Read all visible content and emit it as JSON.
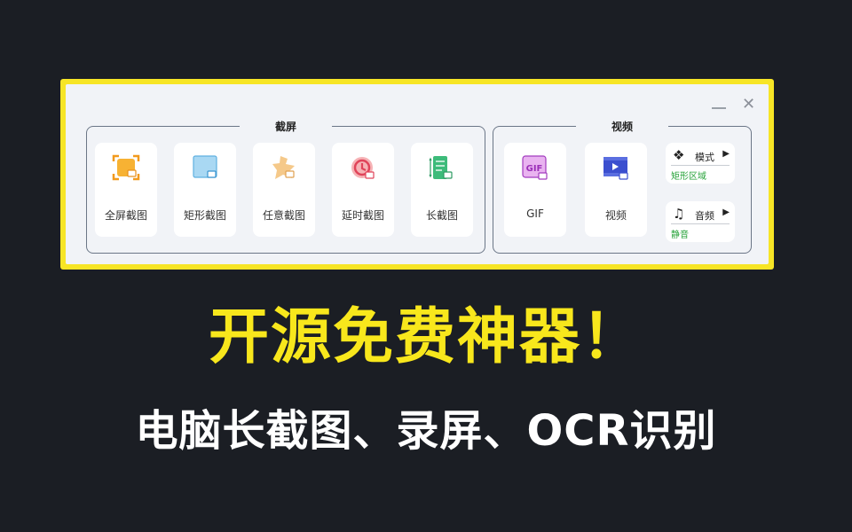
{
  "window": {
    "minimize_glyph": "—",
    "close_glyph": "✕"
  },
  "screenshot_group": {
    "title": "截屏",
    "tools": [
      {
        "label": "全屏截图",
        "icon": "fullscreen-capture-icon"
      },
      {
        "label": "矩形截图",
        "icon": "rect-capture-icon"
      },
      {
        "label": "任意截图",
        "icon": "freeform-capture-icon"
      },
      {
        "label": "延时截图",
        "icon": "delay-capture-icon"
      },
      {
        "label": "长截图",
        "icon": "long-capture-icon"
      }
    ]
  },
  "video_group": {
    "title": "视频",
    "tools": [
      {
        "label": "GIF",
        "icon": "gif-icon",
        "icon_text": "GIF"
      },
      {
        "label": "视频",
        "icon": "video-icon"
      }
    ],
    "mode": {
      "label": "模式",
      "value": "矩形区域",
      "icon": "mode-icon"
    },
    "audio": {
      "label": "音频",
      "value": "静音",
      "icon": "music-note-icon"
    }
  },
  "headline": "开源免费神器！",
  "subheadline": "电脑长截图、录屏、OCR识别",
  "colors": {
    "background": "#1b1e24",
    "frame": "#f7e526",
    "headline": "#f8e71c",
    "status_green": "#27a33a"
  }
}
